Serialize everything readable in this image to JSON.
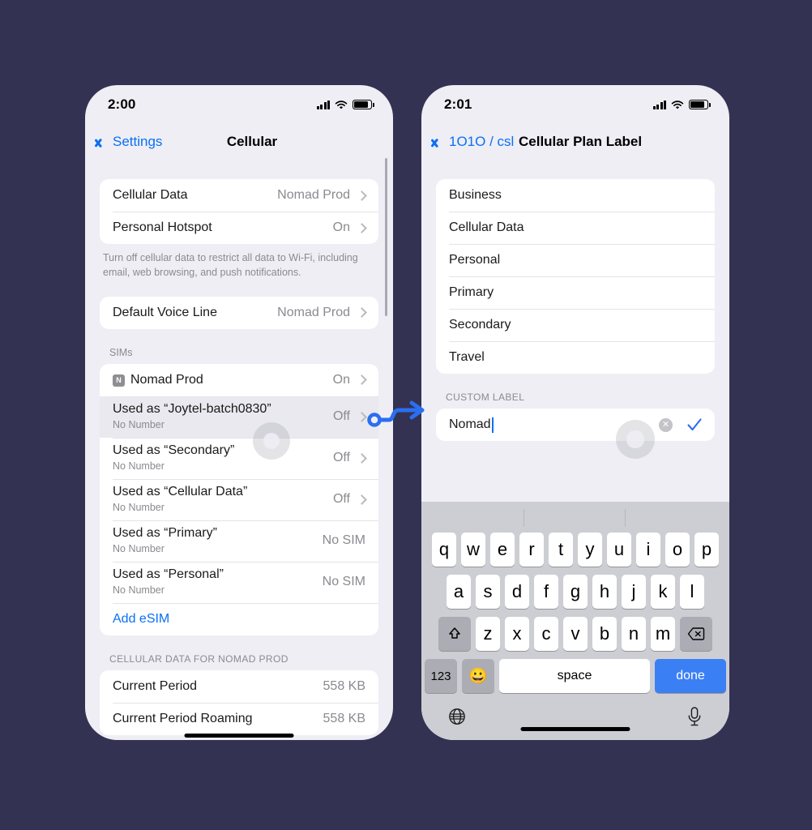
{
  "background_color": "#333252",
  "accent_color": "#0a70f5",
  "phone_left": {
    "status_bar": {
      "time": "2:00",
      "signal_icon": "cellular-bars-icon",
      "wifi_icon": "wifi-icon",
      "battery_icon": "battery-icon"
    },
    "nav": {
      "back_label": "Settings",
      "title": "Cellular"
    },
    "group_1": [
      {
        "title": "Cellular Data",
        "value": "Nomad Prod",
        "chevron": true
      },
      {
        "title": "Personal Hotspot",
        "value": "On",
        "chevron": true
      }
    ],
    "footnote": "Turn off cellular data to restrict all data to Wi-Fi, including email, web browsing, and push notifications.",
    "group_2": [
      {
        "title": "Default Voice Line",
        "value": "Nomad Prod",
        "chevron": true
      }
    ],
    "sims_header": "SIMs",
    "sims": [
      {
        "badge": "N",
        "title": "Nomad Prod",
        "sub": "",
        "value": "On",
        "chevron": true,
        "highlight": false
      },
      {
        "badge": "",
        "title": "Used as “Joytel-batch0830”",
        "sub": "No Number",
        "value": "Off",
        "chevron": true,
        "highlight": true
      },
      {
        "badge": "",
        "title": "Used as “Secondary”",
        "sub": "No Number",
        "value": "Off",
        "chevron": true,
        "highlight": false
      },
      {
        "badge": "",
        "title": "Used as “Cellular Data”",
        "sub": "No Number",
        "value": "Off",
        "chevron": true,
        "highlight": false
      },
      {
        "badge": "",
        "title": "Used as “Primary”",
        "sub": "No Number",
        "value": "No SIM",
        "chevron": false,
        "highlight": false
      },
      {
        "badge": "",
        "title": "Used as “Personal”",
        "sub": "No Number",
        "value": "No SIM",
        "chevron": false,
        "highlight": false
      }
    ],
    "add_esim_label": "Add eSIM",
    "data_header": "CELLULAR DATA FOR NOMAD PROD",
    "data_rows": [
      {
        "title": "Current Period",
        "value": "558 KB"
      },
      {
        "title": "Current Period Roaming",
        "value": "558 KB"
      }
    ]
  },
  "phone_right": {
    "status_bar": {
      "time": "2:01",
      "signal_icon": "cellular-bars-icon",
      "wifi_icon": "wifi-icon",
      "battery_icon": "battery-icon"
    },
    "nav": {
      "back_label": "1O1O / csl",
      "title": "Cellular Plan Label"
    },
    "label_options": [
      {
        "title": "Business"
      },
      {
        "title": "Cellular Data"
      },
      {
        "title": "Personal"
      },
      {
        "title": "Primary"
      },
      {
        "title": "Secondary"
      },
      {
        "title": "Travel"
      }
    ],
    "custom_label": {
      "header": "CUSTOM LABEL",
      "value": "Nomad",
      "placeholder": "Custom Label",
      "clear_icon": "clear-circle-icon",
      "confirm_icon": "checkmark-icon"
    },
    "keyboard": {
      "row1": [
        "q",
        "w",
        "e",
        "r",
        "t",
        "y",
        "u",
        "i",
        "o",
        "p"
      ],
      "row2": [
        "a",
        "s",
        "d",
        "f",
        "g",
        "h",
        "j",
        "k",
        "l"
      ],
      "row3": [
        "z",
        "x",
        "c",
        "v",
        "b",
        "n",
        "m"
      ],
      "shift_icon": "shift-arrow-icon",
      "backspace_icon": "backspace-icon",
      "numbers_label": "123",
      "emoji_icon": "emoji-smiley-icon",
      "space_label": "space",
      "done_label": "done",
      "globe_icon": "globe-icon",
      "mic_icon": "microphone-icon"
    }
  },
  "annotation": {
    "arrow_icon": "curved-arrow-icon",
    "arrow_color": "#2b6ef0",
    "tap_indicator_icon": "tap-circle-icon"
  }
}
